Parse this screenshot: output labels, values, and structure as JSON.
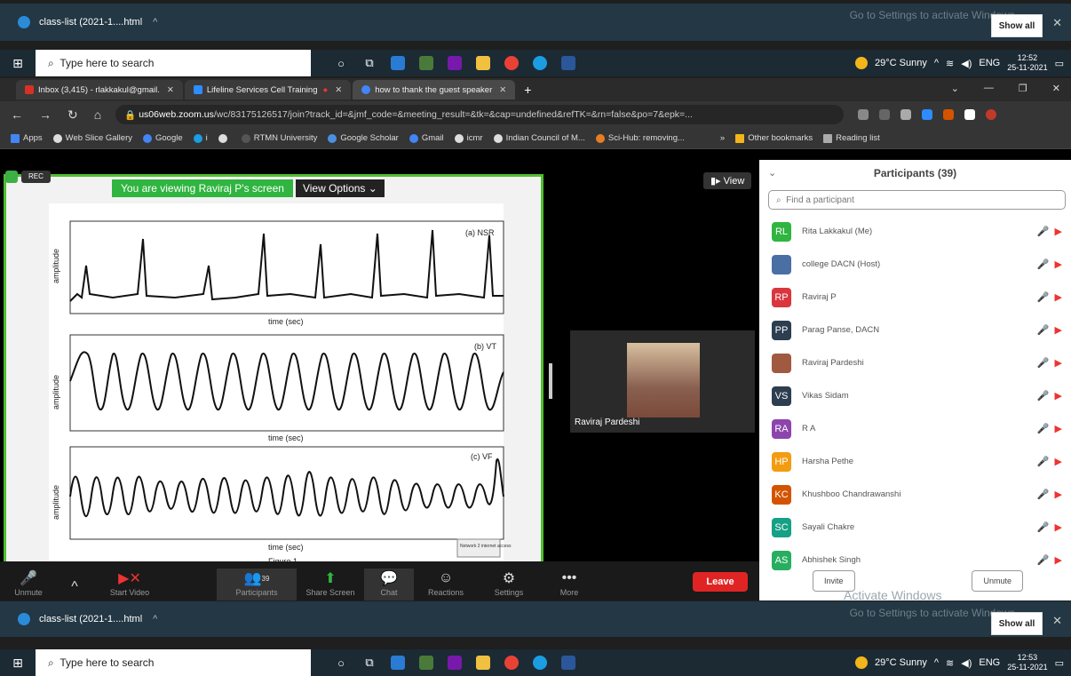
{
  "download_bar": {
    "file": "class-list (2021-1....html",
    "activate_text": "Go to Settings to activate Windows.",
    "show_all": "Show all"
  },
  "taskbar": {
    "search_placeholder": "Type here to search",
    "weather": "29°C Sunny",
    "lang": "ENG",
    "time_top": "12:52",
    "date_top": "25-11-2021",
    "time_bottom": "12:53",
    "date_bottom": "25-11-2021"
  },
  "tabs": [
    {
      "label": "Inbox (3,415) - rlakkakul@gmail.",
      "color": "#d93025"
    },
    {
      "label": "Lifeline Services Cell Training",
      "color": "#2d8cff"
    },
    {
      "label": "how to thank the guest speaker",
      "color": "#4285f4"
    }
  ],
  "url": {
    "host": "us06web.zoom.us",
    "path": "/wc/83175126517/join?track_id=&jmf_code=&meeting_result=&tk=&cap=undefined&refTK=&rn=false&po=7&epk=..."
  },
  "bookmarks": [
    "Apps",
    "Web Slice Gallery",
    "Google",
    "RTMN University",
    "Google Scholar",
    "Gmail",
    "icmr",
    "Indian Council of M...",
    "Sci-Hub: removing...",
    "Other bookmarks",
    "Reading list"
  ],
  "zoom": {
    "rec": "REC",
    "viewing": "You are viewing Raviraj P's screen",
    "view_options": "View Options",
    "view_btn": "View",
    "video_name": "Raviraj Pardeshi",
    "network": "Network 2 internet access"
  },
  "figure": {
    "panels": [
      "(a) NSR",
      "(b) VT",
      "(c) VF"
    ],
    "ylabel": "amplitude",
    "xlabel": "time (sec)",
    "caption": "Figure 1"
  },
  "controls": [
    {
      "label": "Unmute",
      "icon": "mic-off-icon"
    },
    {
      "label": "Start Video",
      "icon": "video-off-icon"
    },
    {
      "label": "Participants",
      "icon": "participants-icon",
      "badge": "39"
    },
    {
      "label": "Share Screen",
      "icon": "share-icon"
    },
    {
      "label": "Chat",
      "icon": "chat-icon"
    },
    {
      "label": "Reactions",
      "icon": "reactions-icon"
    },
    {
      "label": "Settings",
      "icon": "gear-icon"
    },
    {
      "label": "More",
      "icon": "more-icon"
    }
  ],
  "leave": "Leave",
  "participants": {
    "title": "Participants (39)",
    "search_placeholder": "Find a participant",
    "list": [
      {
        "initials": "RL",
        "name": "Rita Lakkakul (Me)",
        "color": "#2fb540"
      },
      {
        "initials": "",
        "name": "college DACN (Host)",
        "color": "#4a6fa5"
      },
      {
        "initials": "RP",
        "name": "Raviraj P",
        "color": "#d9363e"
      },
      {
        "initials": "PP",
        "name": "Parag Panse, DACN",
        "color": "#2c3e50"
      },
      {
        "initials": "",
        "name": "Raviraj Pardeshi",
        "color": "#a05a40"
      },
      {
        "initials": "VS",
        "name": "Vikas Sidam",
        "color": "#2c3e50"
      },
      {
        "initials": "RA",
        "name": "R A",
        "color": "#8e44ad"
      },
      {
        "initials": "HP",
        "name": "Harsha Pethe",
        "color": "#f39c12"
      },
      {
        "initials": "KC",
        "name": "Khushboo Chandrawanshi",
        "color": "#d35400"
      },
      {
        "initials": "SC",
        "name": "Sayali Chakre",
        "color": "#16a085"
      },
      {
        "initials": "AS",
        "name": "Abhishek Singh",
        "color": "#27ae60"
      }
    ],
    "invite": "Invite",
    "unmute": "Unmute",
    "watermark": "Activate Windows"
  }
}
